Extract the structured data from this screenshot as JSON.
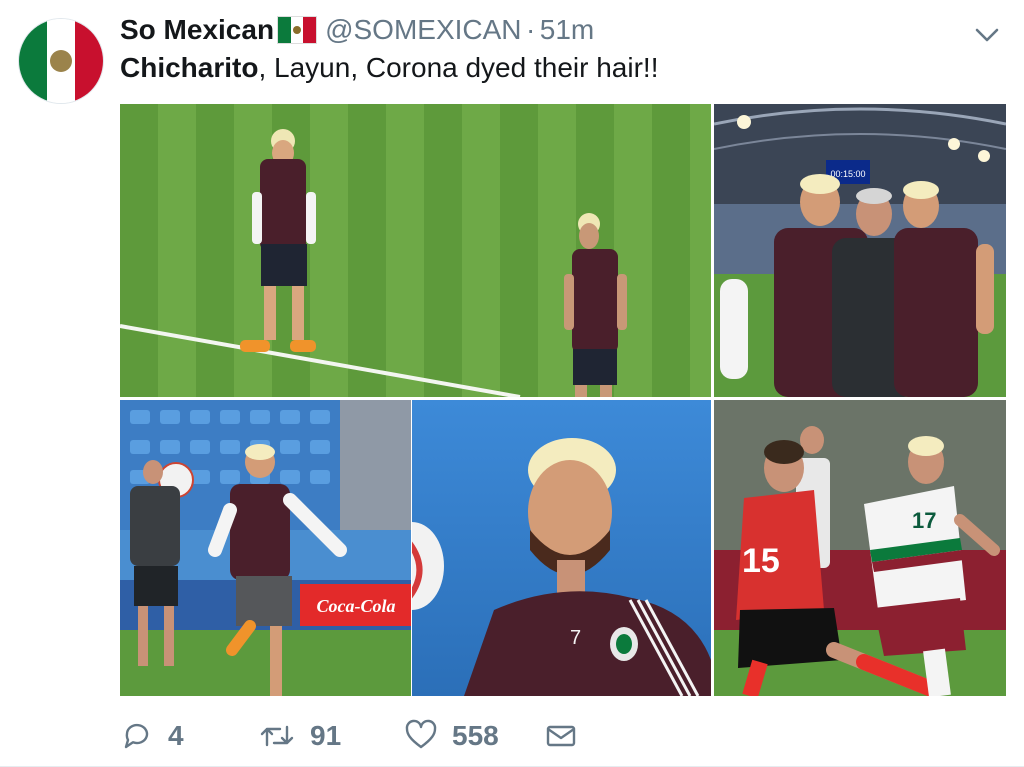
{
  "tweet": {
    "display_name": "So Mexican",
    "handle": "@SOMEXICAN",
    "separator": "·",
    "time": "51m",
    "text_bold": "Chicharito",
    "text_rest": ", Layun, Corona dyed their hair!!"
  },
  "media": {
    "photos": [
      {
        "scoreboard": "00:15:00"
      },
      {
        "banner": "Coca-Cola"
      },
      {
        "jersey_number": "7"
      },
      {
        "jersey_number_left": "15",
        "jersey_number_right": "17"
      }
    ]
  },
  "actions": {
    "replies": "4",
    "retweets": "91",
    "likes": "558"
  },
  "colors": {
    "muted": "#657786",
    "pitch_green": "#6ea947",
    "kit_maroon": "#4a1f2b",
    "korea_red": "#d8312f",
    "flag_green": "#0b7a3c",
    "flag_red": "#c8102e"
  },
  "icons": [
    "flag-mexico-icon",
    "chevron-down-icon",
    "reply-icon",
    "retweet-icon",
    "heart-icon",
    "mail-icon"
  ]
}
